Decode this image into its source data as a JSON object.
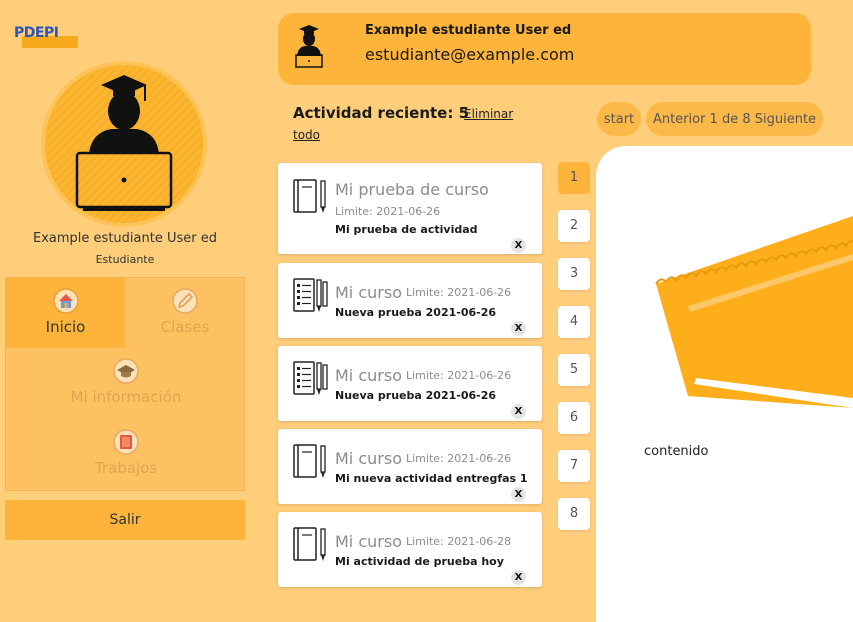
{
  "app": {
    "logo_text": "PDEPI"
  },
  "profile": {
    "name": "Example estudiante User ed",
    "role": "Estudiante"
  },
  "menu": {
    "items": [
      {
        "label": "Inicio",
        "icon": "home-icon",
        "active": true
      },
      {
        "label": "Clases",
        "icon": "pencil-icon",
        "active": false
      },
      {
        "label": "Mi información",
        "icon": "graduation-cap-icon",
        "active": false
      },
      {
        "label": "Trabajos",
        "icon": "book-icon",
        "active": false
      }
    ],
    "logout_label": "Salir"
  },
  "user": {
    "name": "Example estudiante User ed",
    "email": "estudiante@example.com"
  },
  "activity": {
    "title": "Actividad reciente: 5",
    "delete_all_1": "Eliminar",
    "delete_all_2": "todo",
    "start_label": "start",
    "nav_label": "Anterior 1 de 8 Siguiente",
    "items": [
      {
        "course": "Mi prueba de curso",
        "limit": "Limite: 2021-06-26",
        "activity": "Mi prueba de actividad",
        "close": "X",
        "icon": "notebook-icon"
      },
      {
        "course": "Mi curso",
        "limit": "Limite: 2021-06-26",
        "activity": "Nueva prueba 2021-06-26",
        "close": "X",
        "icon": "checklist-icon"
      },
      {
        "course": "Mi curso",
        "limit": "Limite: 2021-06-26",
        "activity": "Nueva prueba 2021-06-26",
        "close": "X",
        "icon": "checklist-icon"
      },
      {
        "course": "Mi curso",
        "limit": "Limite: 2021-06-26",
        "activity": "Mi nueva actividad entregfas 1",
        "close": "X",
        "icon": "notebook-icon"
      },
      {
        "course": "Mi curso",
        "limit": "Limite: 2021-06-28",
        "activity": "Mi actividad de prueba hoy",
        "close": "X",
        "icon": "notebook-icon"
      }
    ]
  },
  "pagination": {
    "pages": [
      "1",
      "2",
      "3",
      "4",
      "5",
      "6",
      "7",
      "8"
    ],
    "current": "1"
  },
  "content": {
    "label": "contenido"
  },
  "colors": {
    "background": "#fece7b",
    "accent": "#feb43a",
    "logo_blue": "#2a56b8"
  }
}
